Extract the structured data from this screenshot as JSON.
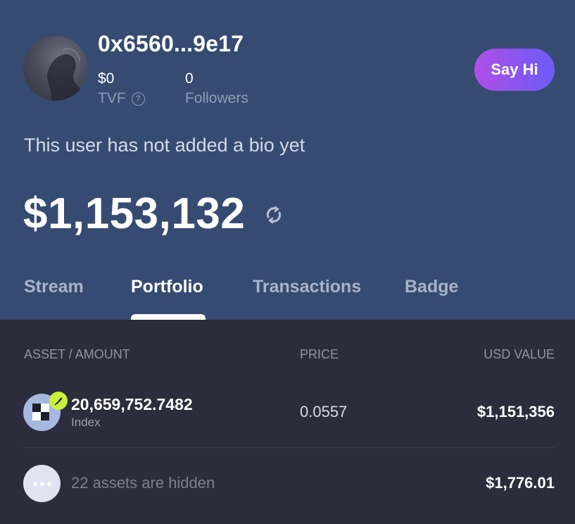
{
  "profile": {
    "username": "0x6560...9e17",
    "tvf_value": "$0",
    "tvf_label": "TVF",
    "followers_value": "0",
    "followers_label": "Followers",
    "say_hi_label": "Say Hi",
    "bio": "This user has not added a bio yet",
    "balance": "$1,153,132"
  },
  "tabs": [
    {
      "label": "Stream"
    },
    {
      "label": "Portfolio",
      "active": true
    },
    {
      "label": "Transactions"
    },
    {
      "label": "Badge"
    }
  ],
  "table": {
    "headers": {
      "asset": "ASSET / AMOUNT",
      "price": "PRICE",
      "usd": "USD VALUE"
    },
    "rows": [
      {
        "amount": "20,659,752.7482",
        "name": "Index",
        "price": "0.0557",
        "usd": "$1,151,356"
      }
    ],
    "hidden": {
      "text": "22 assets are hidden",
      "usd": "$1,776.01"
    }
  },
  "colors": {
    "header_bg": "#364b71",
    "body_bg": "#2b2d3c",
    "say_hi_gradient_start": "#b04ee8",
    "say_hi_gradient_end": "#6b5cf6",
    "badge_green": "#c8f03c"
  }
}
